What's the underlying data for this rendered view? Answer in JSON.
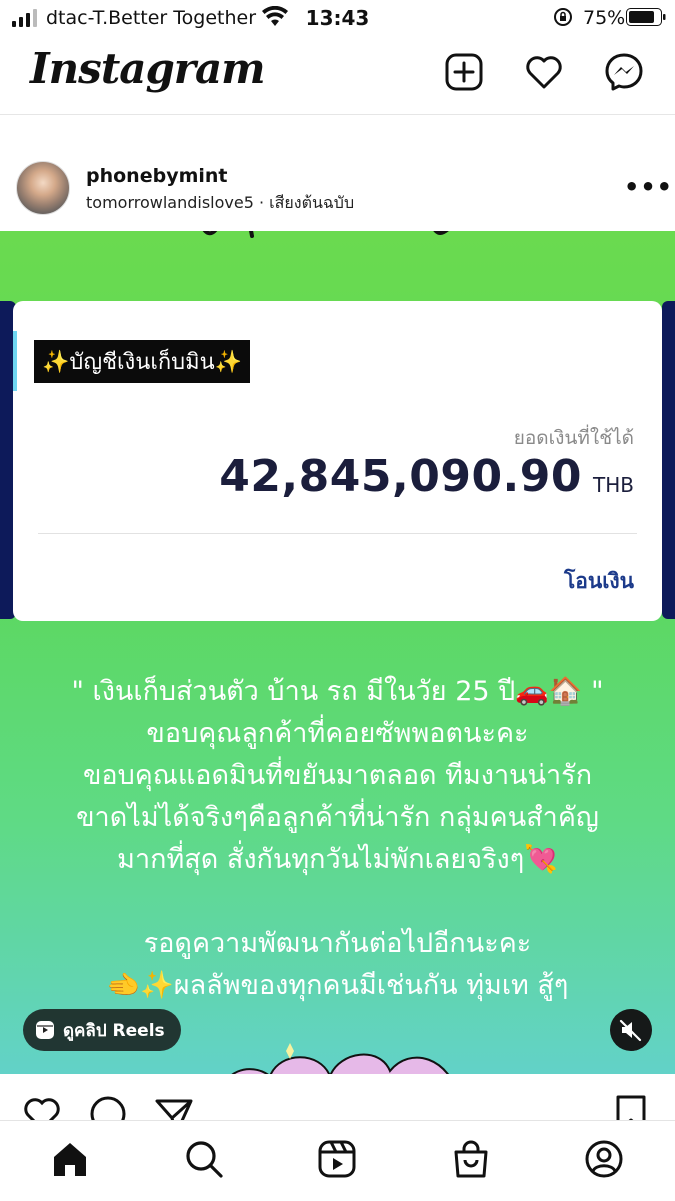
{
  "status_bar": {
    "carrier": "dtac-T.Better Together",
    "time": "13:43",
    "battery": "75%"
  },
  "header": {
    "logo": "Instagram"
  },
  "post": {
    "username": "phonebymint",
    "audio": "tomorrowlandislove5 · เสียงต้นฉบับ",
    "card": {
      "tag": "✨บัญชีเงินเก็บมิน✨",
      "balance_label": "ยอดเงินที่ใช้ได้",
      "amount": "42,845,090.90",
      "currency": "THB",
      "transfer": "โอนเงิน"
    },
    "caption_lines": [
      "\" เงินเก็บส่วนตัว บ้าน รถ มีในวัย 25 ปี🚗🏠 \"",
      "ขอบคุณลูกค้าที่คอยซัพพอตนะคะ",
      "ขอบคุณแอดมินที่ขยันมาตลอด ทีมงานน่ารัก",
      "ขาดไม่ได้จริงๆคือลูกค้าที่น่ารัก กลุ่มคนสำคัญ",
      "มากที่สุด สั่งกันทุกวันไม่พักเลยจริงๆ💘",
      "",
      "รอดูความพัฒนากันต่อไปอีกนะคะ",
      "🫲✨ผลลัพของทุกคนมีเช่นกัน ทุ่มเท สู้ๆ"
    ],
    "reels_label": "ดูคลิป Reels"
  },
  "icons": {
    "new_post": "plus-square-icon",
    "likes": "heart-icon",
    "messenger": "messenger-icon",
    "home": "home-icon",
    "search": "search-icon",
    "reels": "reels-icon",
    "shop": "shop-icon",
    "profile": "profile-icon"
  }
}
